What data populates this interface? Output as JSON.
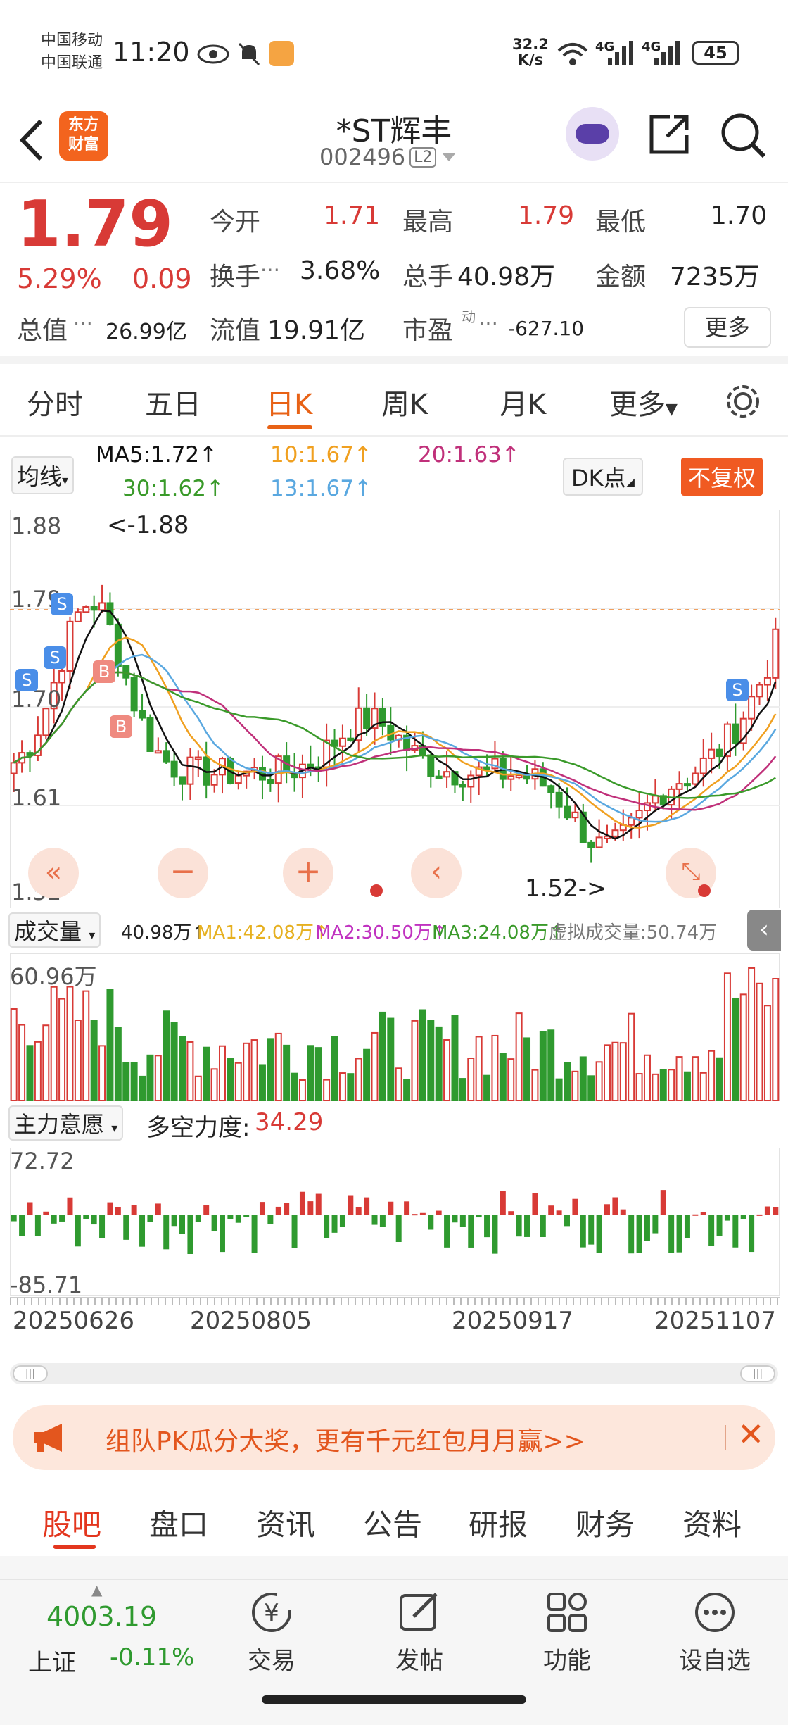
{
  "status_bar": {
    "carrier1": "中国移动",
    "carrier2": "中国联通",
    "time": "11:20",
    "net_speed": "32.2",
    "net_unit": "K/s",
    "signal1": "4G",
    "signal2": "4G",
    "battery": "45"
  },
  "header": {
    "logo_line1": "东方",
    "logo_line2": "财富",
    "title": "*ST辉丰",
    "code": "002496",
    "level": "L2"
  },
  "quote": {
    "price": "1.79",
    "change_pct": "5.29%",
    "change_amt": "0.09",
    "open_label": "今开",
    "open": "1.71",
    "high_label": "最高",
    "high": "1.79",
    "low_label": "最低",
    "low": "1.70",
    "turnover_label": "换手",
    "turnover": "3.68%",
    "volume_label": "总手",
    "volume": "40.98万",
    "amount_label": "金额",
    "amount": "7235万",
    "mktcap_label": "总值",
    "mktcap": "26.99亿",
    "float_label": "流值",
    "float_cap": "19.91亿",
    "pe_label": "市盈",
    "pe_sup": "动",
    "pe": "-627.10",
    "more": "更多"
  },
  "period_tabs": [
    "分时",
    "五日",
    "日K",
    "周K",
    "月K",
    "更多"
  ],
  "active_period": "日K",
  "ma_legend": {
    "selector": "均线",
    "ma5": "MA5:1.72↑",
    "ma10": "10:1.67↑",
    "ma20": "20:1.63↑",
    "ma30": "30:1.62↑",
    "ma13": "13:1.67↑",
    "dk": "DK点",
    "fq": "不复权"
  },
  "price_axis": {
    "top": "1.88",
    "l2": "1.79",
    "l3": "1.70",
    "l4": "1.61",
    "bottom": "1.52",
    "max_marker": "<-1.88",
    "min_marker": "1.52->"
  },
  "volume": {
    "selector": "成交量",
    "vol": "40.98万↑",
    "ma1": "MA1:42.08万↑",
    "ma2": "MA2:30.50万↑",
    "ma3": "MA3:24.08万↑",
    "virtual": "虚拟成交量:50.74万",
    "axis_top": "60.96万"
  },
  "indicator": {
    "selector": "主力意愿",
    "name": "多空力度:",
    "value": "34.29",
    "axis_top": "72.72",
    "axis_bottom": "-85.71"
  },
  "dates": [
    "20250626",
    "20250805",
    "20250917",
    "20251107"
  ],
  "banner": {
    "text": "组队PK瓜分大奖，更有千元红包月月赢>>"
  },
  "bottom_tabs": [
    "股吧",
    "盘口",
    "资讯",
    "公告",
    "研报",
    "财务",
    "资料"
  ],
  "footer": {
    "index_value": "4003.19",
    "index_name": "上证",
    "index_change": "-0.11%",
    "items": [
      "交易",
      "发帖",
      "功能",
      "设自选"
    ]
  },
  "colors": {
    "up": "#d83a36",
    "down": "#2f9a2f",
    "accent": "#e86216",
    "ma5": "#111111",
    "ma10": "#f0a020",
    "ma20": "#c0307a",
    "ma30": "#3a9a2a",
    "ma13": "#5aa8e0"
  }
}
